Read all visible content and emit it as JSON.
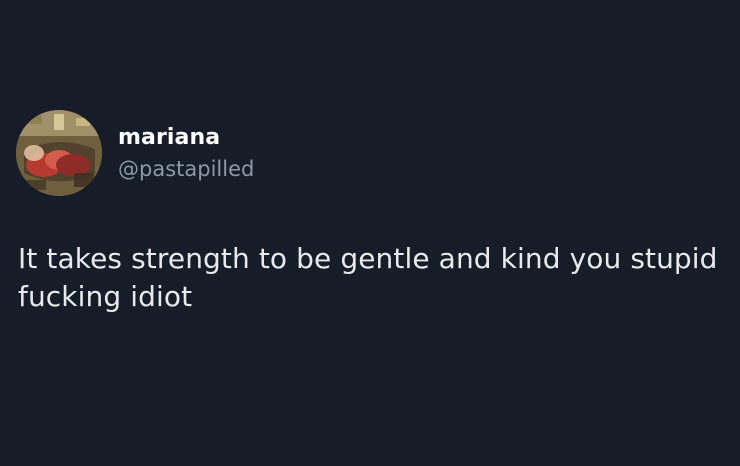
{
  "tweet": {
    "author": {
      "display_name": "mariana",
      "handle": "@pastapilled"
    },
    "text": "It takes strength to be gentle and kind you stupid fucking idiot"
  },
  "theme": {
    "background": "#161d28",
    "text_primary": "#e7e9ea",
    "text_secondary": "#8b98a5"
  },
  "icons": {
    "avatar": "profile-photo"
  }
}
